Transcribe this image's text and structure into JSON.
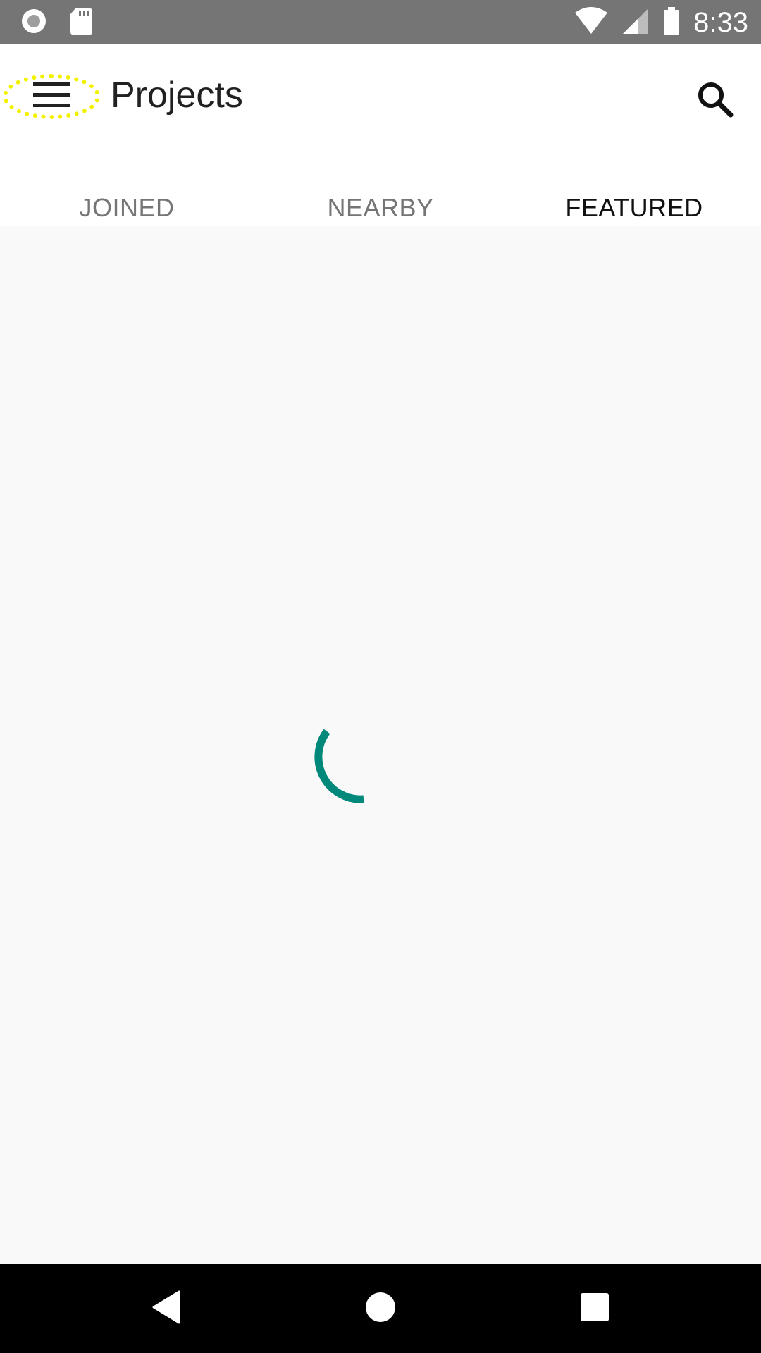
{
  "status_bar": {
    "time": "8:33",
    "icons": [
      "record-icon",
      "sd-card-icon",
      "wifi-icon",
      "signal-icon",
      "battery-icon"
    ]
  },
  "app_bar": {
    "title": "Projects",
    "menu_icon": "hamburger-menu-icon",
    "search_icon": "search-icon"
  },
  "tabs": [
    {
      "label": "JOINED",
      "active": false
    },
    {
      "label": "NEARBY",
      "active": false
    },
    {
      "label": "FEATURED",
      "active": true
    }
  ],
  "content": {
    "state": "loading",
    "spinner_icon": "loading-spinner-icon"
  },
  "nav_bar": {
    "buttons": [
      "back-icon",
      "home-icon",
      "recents-icon"
    ]
  },
  "colors": {
    "status_bar": "#757575",
    "tab_indicator": "#6a9f18",
    "spinner": "#00897b",
    "menu_highlight": "#f2f200",
    "background": "#f9f9f9"
  }
}
